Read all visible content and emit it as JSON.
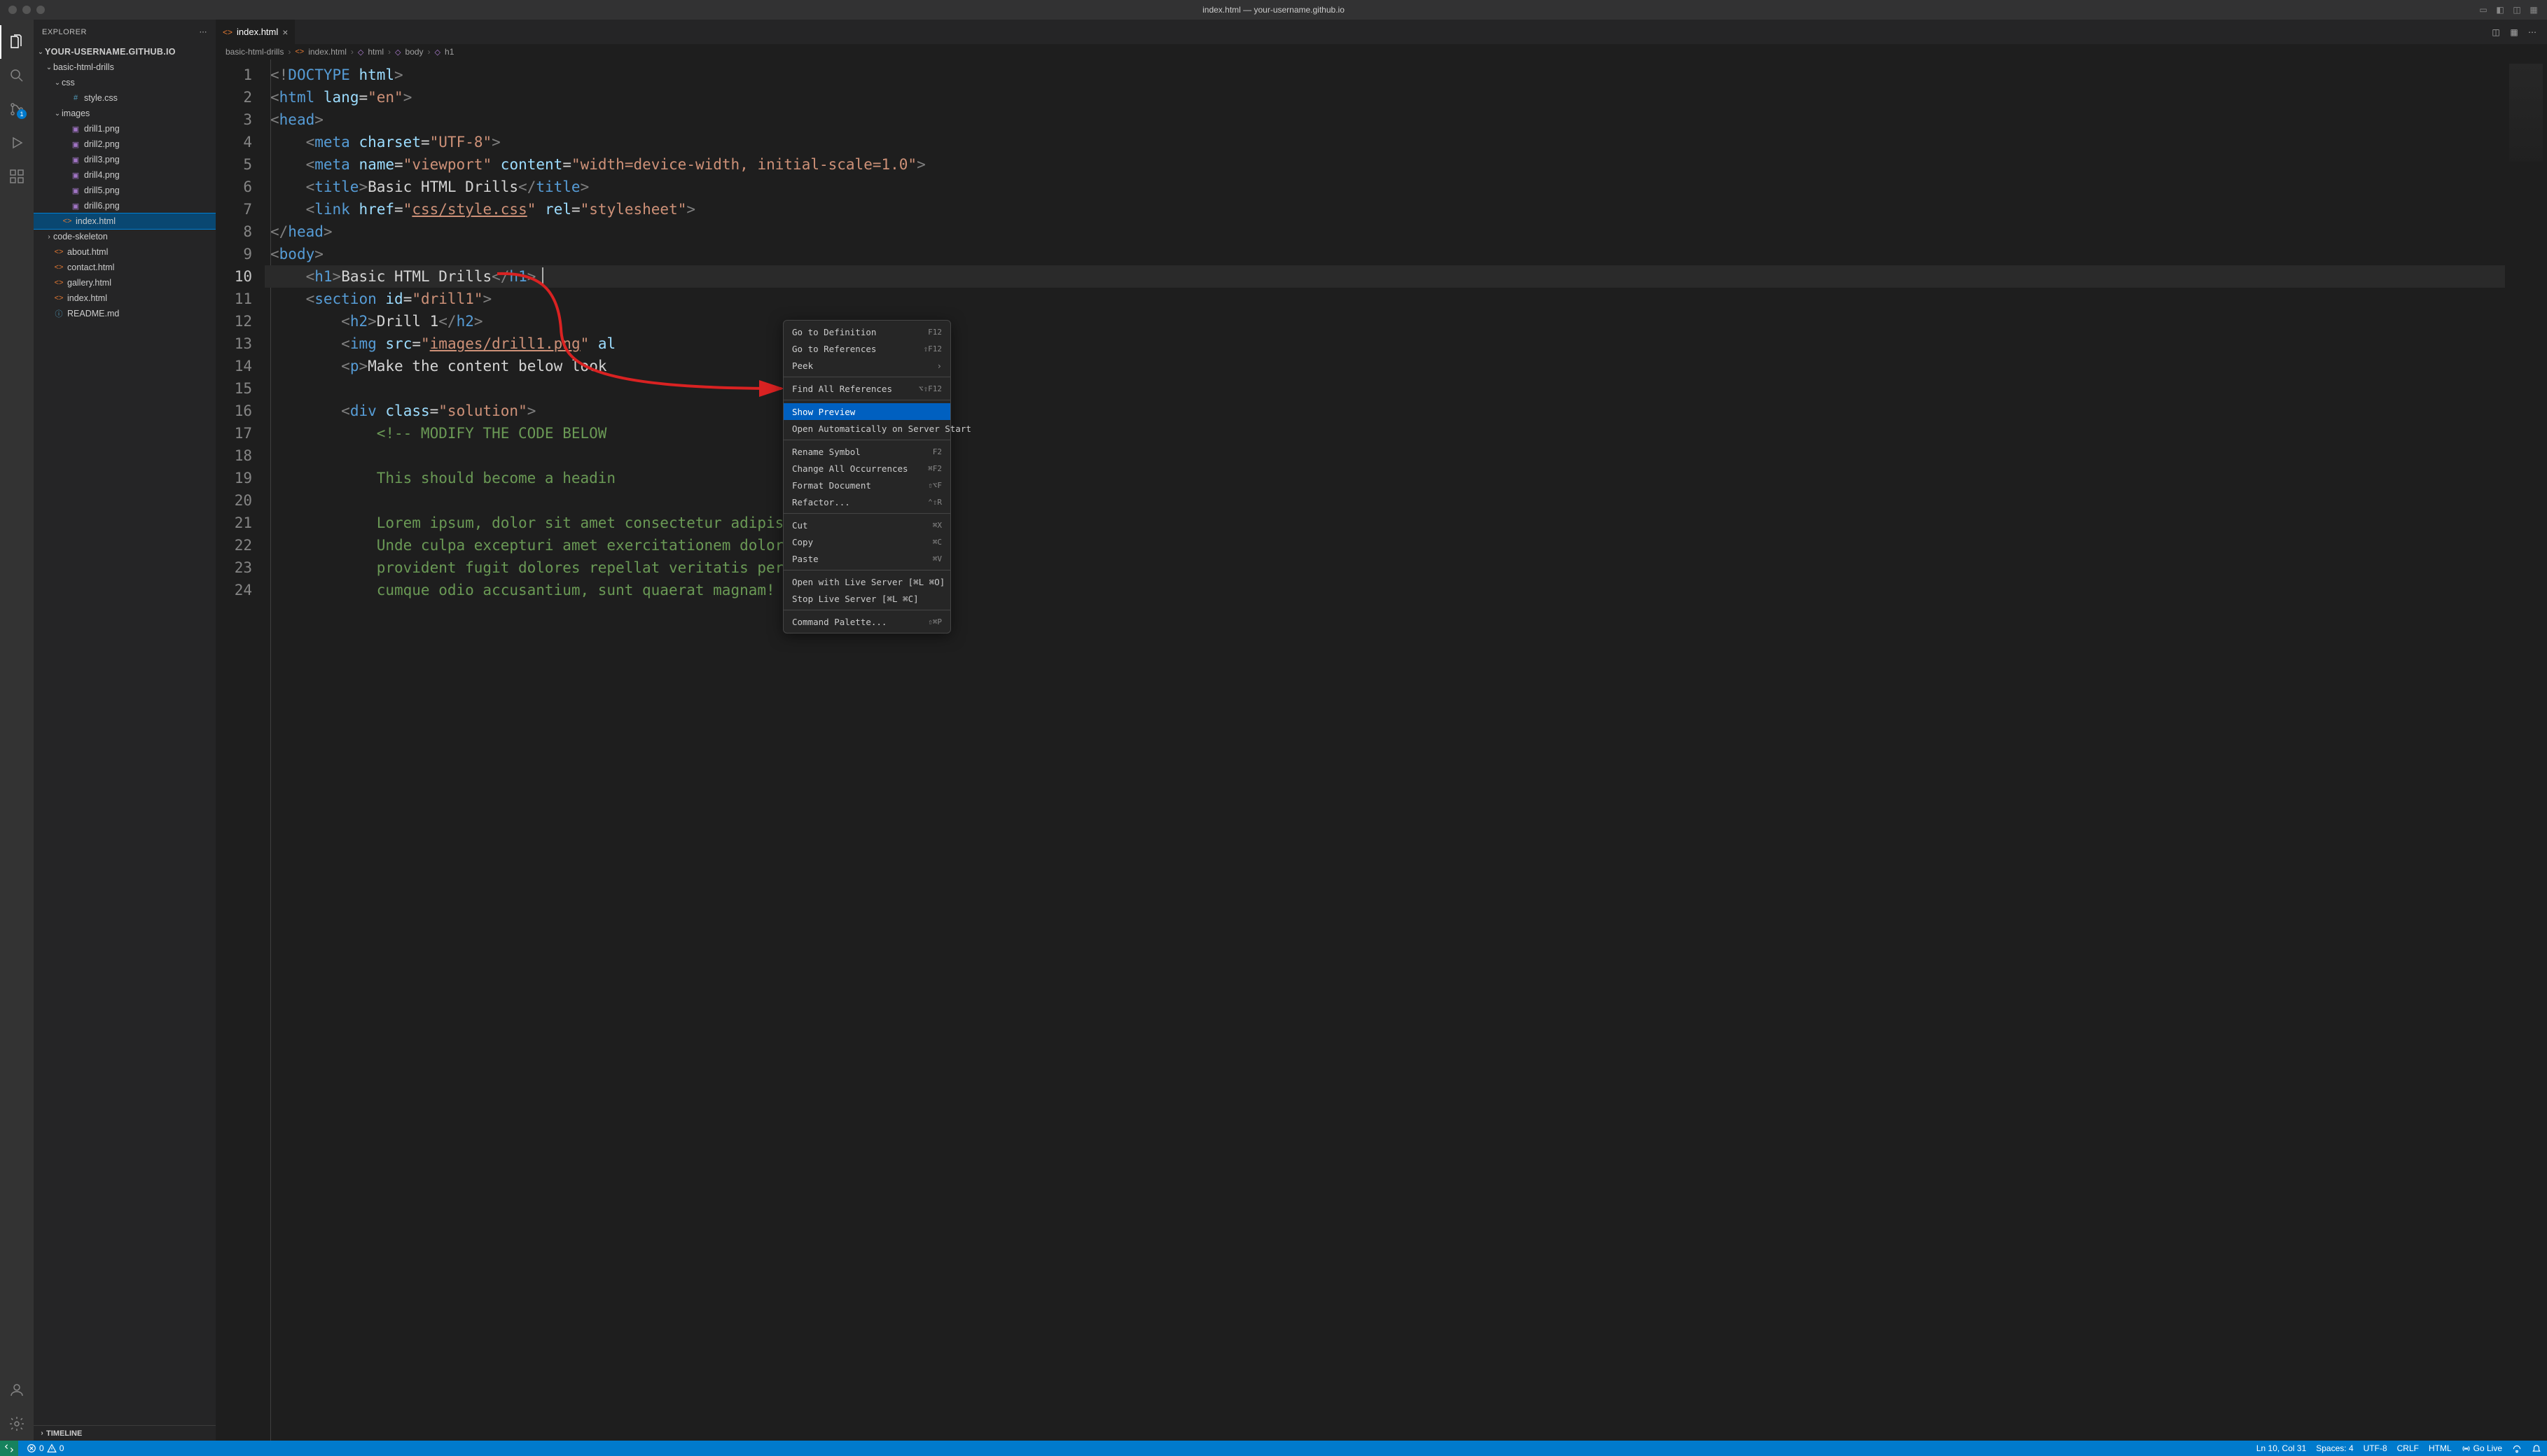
{
  "titlebar": {
    "title": "index.html — your-username.github.io"
  },
  "activitybar": {
    "scm_badge": "1"
  },
  "sidebar": {
    "title": "EXPLORER",
    "root": "YOUR-USERNAME.GITHUB.IO",
    "tree": {
      "folder_basic": "basic-html-drills",
      "folder_css": "css",
      "file_style": "style.css",
      "folder_images": "images",
      "file_d1": "drill1.png",
      "file_d2": "drill2.png",
      "file_d3": "drill3.png",
      "file_d4": "drill4.png",
      "file_d5": "drill5.png",
      "file_d6": "drill6.png",
      "file_index_nested": "index.html",
      "folder_codeskel": "code-skeleton",
      "file_about": "about.html",
      "file_contact": "contact.html",
      "file_gallery": "gallery.html",
      "file_index": "index.html",
      "file_readme": "README.md"
    },
    "timeline": "TIMELINE"
  },
  "tab": {
    "label": "index.html"
  },
  "crumbs": {
    "c1": "basic-html-drills",
    "c2": "index.html",
    "c3": "html",
    "c4": "body",
    "c5": "h1"
  },
  "code": {
    "lines": [
      "1",
      "2",
      "3",
      "4",
      "5",
      "6",
      "7",
      "8",
      "9",
      "10",
      "11",
      "12",
      "13",
      "14",
      "15",
      "16",
      "17",
      "18",
      "19",
      "20",
      "21",
      "22",
      "23",
      "24"
    ]
  },
  "ctxmenu": {
    "go_def": "Go to Definition",
    "go_def_sc": "F12",
    "go_ref": "Go to References",
    "go_ref_sc": "⇧F12",
    "peek": "Peek",
    "find_all": "Find All References",
    "find_all_sc": "⌥⇧F12",
    "show_prev": "Show Preview",
    "open_auto": "Open Automatically on Server Start",
    "rename": "Rename Symbol",
    "rename_sc": "F2",
    "change_all": "Change All Occurrences",
    "change_all_sc": "⌘F2",
    "format": "Format Document",
    "format_sc": "⇧⌥F",
    "refactor": "Refactor...",
    "refactor_sc": "⌃⇧R",
    "cut": "Cut",
    "cut_sc": "⌘X",
    "copy": "Copy",
    "copy_sc": "⌘C",
    "paste": "Paste",
    "paste_sc": "⌘V",
    "open_live": "Open with Live Server [⌘L ⌘O]",
    "stop_live": "Stop Live Server [⌘L ⌘C]",
    "palette": "Command Palette...",
    "palette_sc": "⇧⌘P"
  },
  "status": {
    "remote": "",
    "errors": "0",
    "warnings": "0",
    "ln": "Ln 10, Col 31",
    "spaces": "Spaces: 4",
    "encoding": "UTF-8",
    "eol": "CRLF",
    "lang": "HTML",
    "golive": "Go Live"
  }
}
